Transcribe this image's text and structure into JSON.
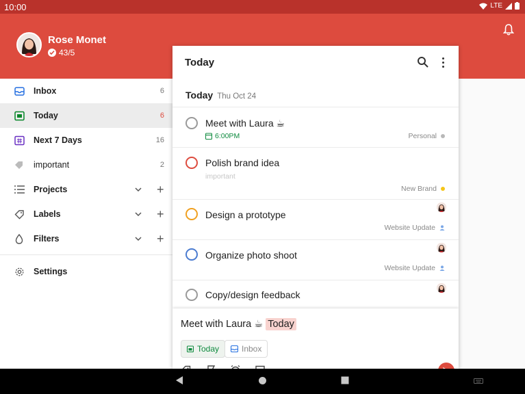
{
  "status": {
    "time": "10:00",
    "network": "LTE"
  },
  "user": {
    "name": "Rose Monet",
    "karma": "43/5"
  },
  "sidebar": {
    "items": [
      {
        "label": "Inbox",
        "count": "6"
      },
      {
        "label": "Today",
        "count": "6"
      },
      {
        "label": "Next 7 Days",
        "count": "16"
      },
      {
        "label": "important",
        "count": "2"
      },
      {
        "label": "Projects"
      },
      {
        "label": "Labels"
      },
      {
        "label": "Filters"
      },
      {
        "label": "Settings"
      }
    ]
  },
  "panel": {
    "title": "Today",
    "section_title": "Today",
    "section_date": "Thu Oct 24",
    "tasks": [
      {
        "name": "Meet with Laura ☕",
        "time": "6:00PM",
        "project": "Personal",
        "priority_color": "#999999"
      },
      {
        "name": "Polish brand idea",
        "label": "important",
        "project": "New Brand",
        "priority_color": "#dd4b3e"
      },
      {
        "name": "Design a prototype",
        "project": "Website Update",
        "priority_color": "#f0a020"
      },
      {
        "name": "Organize photo shoot",
        "project": "Website Update",
        "priority_color": "#4a7bd0"
      },
      {
        "name": "Copy/design feedback"
      }
    ]
  },
  "quick_add": {
    "text": "Meet with Laura ☕",
    "highlight": "Today",
    "chip_today": "Today",
    "chip_inbox": "Inbox"
  },
  "colors": {
    "brand": "#dd4b3e",
    "green": "#0e8a3e",
    "blue": "#4a7bd0",
    "orange": "#f0a020"
  }
}
